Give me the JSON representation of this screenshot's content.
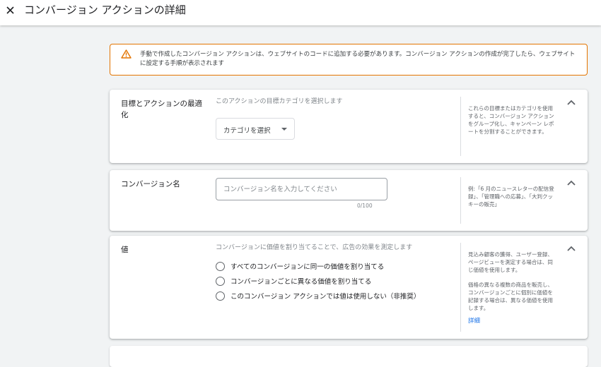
{
  "header": {
    "title": "コンバージョン アクションの詳細",
    "close_icon": "close-icon"
  },
  "warning": {
    "icon": "warning-icon",
    "text": "手動で作成したコンバージョン アクションは、ウェブサイトのコードに追加する必要があります。コンバージョン アクションの作成が完了したら、ウェブサイトに設定する手順が表示されます",
    "border_color": "#e37400"
  },
  "goal_card": {
    "title": "目標とアクションの最適化",
    "description": "このアクションの目標カテゴリを選択します",
    "select_label": "カテゴリを選択",
    "side_text": "これらの目標またはカテゴリを使用すると、コンバージョン アクションをグループ化し、キャンペーン レポートを分割することができます。"
  },
  "name_card": {
    "title": "コンバージョン名",
    "input_placeholder": "コンバージョン名を入力してください",
    "input_value": "",
    "counter": "0/100",
    "side_text": "例:「6 月のニュースレターの配信登録」、「管理職への応募」、「大判クッキーの販売」"
  },
  "value_card": {
    "title": "値",
    "description": "コンバージョンに価値を割り当てることで、広告の効果を測定します",
    "options": [
      "すべてのコンバージョンに同一の価値を割り当てる",
      "コンバージョンごとに異なる価値を割り当てる",
      "このコンバージョン アクションでは値は使用しない（非推奨）"
    ],
    "side_text_1": "見込み顧客の獲得、ユーザー登録、ページビューを測定する場合は、同じ価値を使用します。",
    "side_text_2": "価格の異なる複数の商品を販売し、コンバージョンごとに個別に価値を記録する場合は、異なる価値を使用します。",
    "link": "詳細"
  },
  "colors": {
    "accent": "#1a73e8",
    "warning": "#e37400",
    "background": "#f1f3f4"
  }
}
